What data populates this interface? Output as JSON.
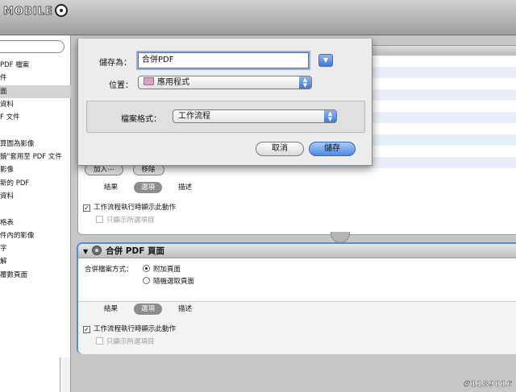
{
  "branding": {
    "logo_text": "MOBILE",
    "watermark": "#1189016"
  },
  "sidebar": {
    "items": [
      {
        "label": "PDF 檔案",
        "selected": false
      },
      {
        "label": "件",
        "selected": false
      },
      {
        "label": "面",
        "selected": true
      },
      {
        "label": "資料",
        "selected": false
      },
      {
        "label": "F 文件",
        "selected": false
      },
      {
        "label": "",
        "selected": false
      },
      {
        "label": "算圖為影像",
        "selected": false
      },
      {
        "label": "鏡\"套用至 PDF 文件",
        "selected": false
      },
      {
        "label": "影像",
        "selected": false
      },
      {
        "label": "新的 PDF",
        "selected": false
      },
      {
        "label": "資料",
        "selected": false
      },
      {
        "label": "",
        "selected": false
      },
      {
        "label": "格表",
        "selected": false
      },
      {
        "label": "件內的影像",
        "selected": false
      },
      {
        "label": "字",
        "selected": false
      },
      {
        "label": "解",
        "selected": false
      },
      {
        "label": "覆數頁面",
        "selected": false
      }
    ]
  },
  "action1": {
    "add_button": "加入⋯",
    "remove_button": "移除",
    "tabs": [
      {
        "label": "結果",
        "active": false
      },
      {
        "label": "選項",
        "active": true
      },
      {
        "label": "描述",
        "active": false
      }
    ],
    "show_action_label": "工作流程執行時顯示此動作",
    "show_action_checked": true,
    "show_selected_label": "只顯示所選項目",
    "show_selected_checked": false
  },
  "action2": {
    "title": "合併 PDF 頁面",
    "merge_label": "合併檔案方式：",
    "options": [
      {
        "label": "附加頁面",
        "selected": true
      },
      {
        "label": "隨機選取頁面",
        "selected": false
      }
    ],
    "tabs": [
      {
        "label": "結果",
        "active": false
      },
      {
        "label": "選項",
        "active": true
      },
      {
        "label": "描述",
        "active": false
      }
    ],
    "show_action_label": "工作流程執行時顯示此動作",
    "show_action_checked": true,
    "show_selected_label": "只顯示所選項目",
    "show_selected_checked": false
  },
  "save_sheet": {
    "save_as_label": "儲存為：",
    "save_as_value": "合併PDF",
    "location_label": "位置：",
    "location_value": "應用程式",
    "format_label": "檔案格式：",
    "format_value": "工作流程",
    "cancel_button": "取消",
    "save_button": "儲存"
  },
  "colors": {
    "focus_ring": "#8db2e8",
    "action_selected_border": "#5a8ad6",
    "default_button": "#4d8ae4"
  }
}
